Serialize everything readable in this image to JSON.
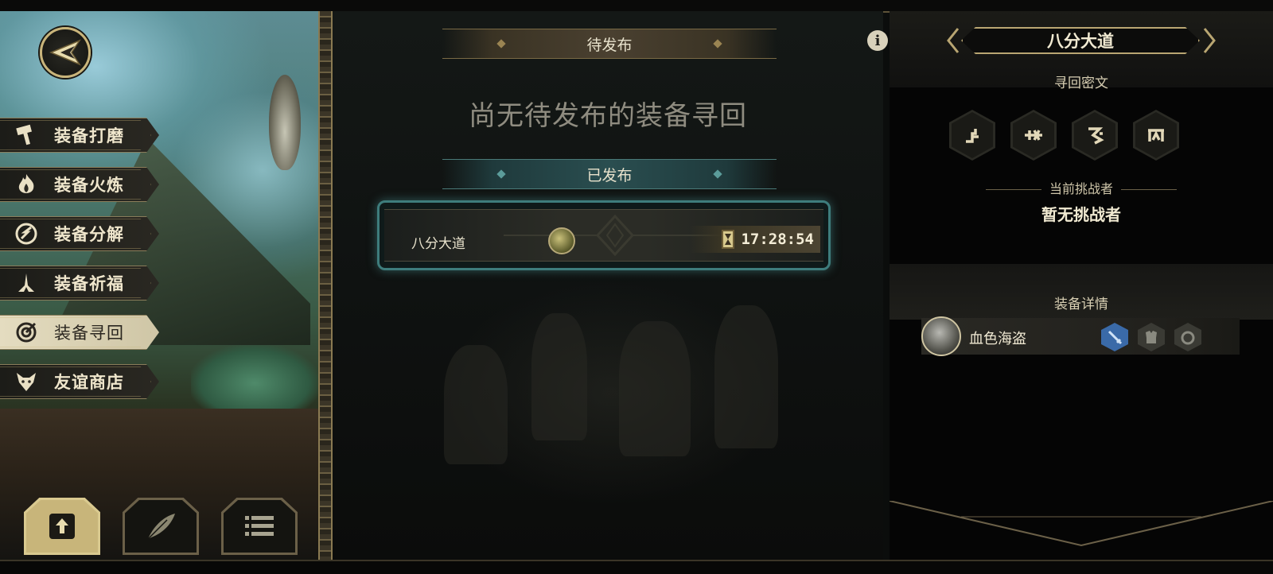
{
  "menu": {
    "items": [
      {
        "label": "装备打磨",
        "icon": "hammer-icon"
      },
      {
        "label": "装备火炼",
        "icon": "flame-icon"
      },
      {
        "label": "装备分解",
        "icon": "shatter-icon"
      },
      {
        "label": "装备祈福",
        "icon": "praying-hands-icon"
      },
      {
        "label": "装备寻回",
        "icon": "target-icon",
        "active": true
      },
      {
        "label": "友谊商店",
        "icon": "fox-icon"
      }
    ]
  },
  "bottom_tabs": [
    {
      "icon": "upload-icon",
      "active": true
    },
    {
      "icon": "feather-icon"
    },
    {
      "icon": "list-icon"
    }
  ],
  "center": {
    "pending_header": "待发布",
    "empty_text": "尚无待发布的装备寻回",
    "published_header": "已发布",
    "entry": {
      "name": "八分大道",
      "timer": "17:28:54"
    },
    "info_label": "i"
  },
  "right": {
    "title": "八分大道",
    "runes_label": "寻回密文",
    "challenger_label": "当前挑战者",
    "challenger_value": "暂无挑战者",
    "details_label": "装备详情",
    "equipment": {
      "name": "血色海盗",
      "slots": [
        "sword-icon",
        "armor-icon",
        "ring-icon"
      ]
    }
  },
  "colors": {
    "gold": "#c9b47a",
    "teal": "#3e7c7c",
    "slot_active": "#5f8fc9"
  }
}
